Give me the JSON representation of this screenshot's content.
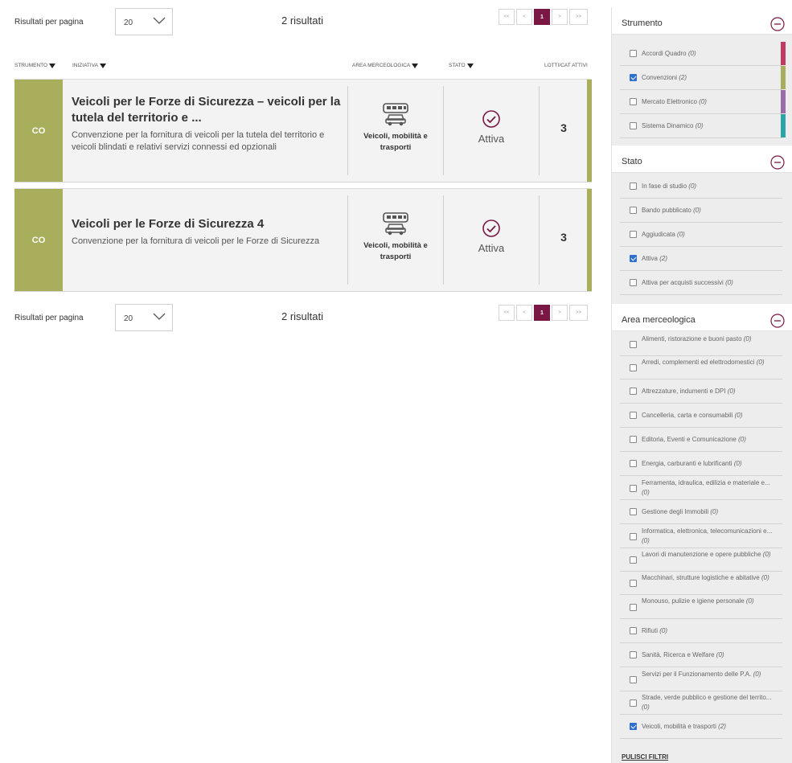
{
  "pager": {
    "rpp_label": "Risultati per pagina",
    "rpp_value": "20",
    "count": "2 risultati",
    "first": "<<",
    "prev": "<",
    "current": "1",
    "next": ">",
    "last": ">>"
  },
  "columns": {
    "strumento": "STRUMENTO",
    "iniziativa": "INIZIATIVA",
    "area": "AREA MERCEOLOGICA",
    "stato": "STATO",
    "lotti": "LOTTI/CAT ATTIVI"
  },
  "results": [
    {
      "badge": "CO",
      "title": "Veicoli per le Forze di Sicurezza – veicoli per la tutela del territorio e ...",
      "description": "Convenzione per la fornitura di veicoli per la tutela del territorio e veicoli blindati e relativi servizi connessi ed opzionali",
      "area_icon": "vehicles-icon",
      "area": "Veicoli, mobilità e trasporti",
      "status_icon": "check-circle-icon",
      "status": "Attiva",
      "lotti": "3"
    },
    {
      "badge": "CO",
      "title": "Veicoli per le Forze di Sicurezza 4",
      "description": "Convenzione per la fornitura di veicoli per le Forze di Sicurezza",
      "area_icon": "vehicles-icon",
      "area": "Veicoli, mobilità e trasporti",
      "status_icon": "check-circle-icon",
      "status": "Attiva",
      "lotti": "3"
    }
  ],
  "filters": {
    "strumento": {
      "title": "Strumento",
      "items": [
        {
          "label": "Accordi Quadro",
          "count": "(0)",
          "checked": false,
          "color": "#c23a64"
        },
        {
          "label": "Convenzioni",
          "count": "(2)",
          "checked": true,
          "color": "#a8ae5c"
        },
        {
          "label": "Mercato Elettronico",
          "count": "(0)",
          "checked": false,
          "color": "#9b6aa8"
        },
        {
          "label": "Sistema Dinamico",
          "count": "(0)",
          "checked": false,
          "color": "#2aa6a4"
        }
      ]
    },
    "stato": {
      "title": "Stato",
      "items": [
        {
          "label": "In fase di studio",
          "count": "(0)",
          "checked": false
        },
        {
          "label": "Bando pubblicato",
          "count": "(0)",
          "checked": false
        },
        {
          "label": "Aggiudicata",
          "count": "(0)",
          "checked": false
        },
        {
          "label": "Attiva",
          "count": "(2)",
          "checked": true
        },
        {
          "label": "Attiva per acquisti successivi",
          "count": "(0)",
          "checked": false
        }
      ]
    },
    "area": {
      "title": "Area merceologica",
      "items": [
        {
          "label": "Alimenti, ristorazione e buoni pasto",
          "count": "(0)",
          "checked": false
        },
        {
          "label": "Arredi, complementi ed elettrodomestici",
          "count": "(0)",
          "checked": false
        },
        {
          "label": "Attrezzature, indumenti e DPI",
          "count": "(0)",
          "checked": false
        },
        {
          "label": "Cancelleria, carta e consumabili",
          "count": "(0)",
          "checked": false
        },
        {
          "label": "Editoria, Eventi e Comunicazione",
          "count": "(0)",
          "checked": false
        },
        {
          "label": "Energia, carburanti e lubrificanti",
          "count": "(0)",
          "checked": false
        },
        {
          "label": "Ferramenta, idraulica, edilizia e materiale e...",
          "count": "(0)",
          "checked": false
        },
        {
          "label": "Gestione degli Immobili",
          "count": "(0)",
          "checked": false
        },
        {
          "label": "Informatica, elettronica, telecomunicazioni e...",
          "count": "(0)",
          "checked": false
        },
        {
          "label": "Lavori di manutenzione e opere pubbliche",
          "count": "(0)",
          "checked": false
        },
        {
          "label": "Macchinari, strutture logistiche e abitative",
          "count": "(0)",
          "checked": false
        },
        {
          "label": "Monouso, pulizie e igiene personale",
          "count": "(0)",
          "checked": false
        },
        {
          "label": "Rifiuti",
          "count": "(0)",
          "checked": false
        },
        {
          "label": "Sanità, Ricerca e Welfare",
          "count": "(0)",
          "checked": false
        },
        {
          "label": "Servizi per il Funzionamento delle P.A.",
          "count": "(0)",
          "checked": false
        },
        {
          "label": "Strade, verde pubblico e gestione del territo...",
          "count": "(0)",
          "checked": false
        },
        {
          "label": "Veicoli, mobilità e trasporti",
          "count": "(2)",
          "checked": true
        }
      ]
    },
    "clear_label": "PULISCI FILTRI"
  }
}
